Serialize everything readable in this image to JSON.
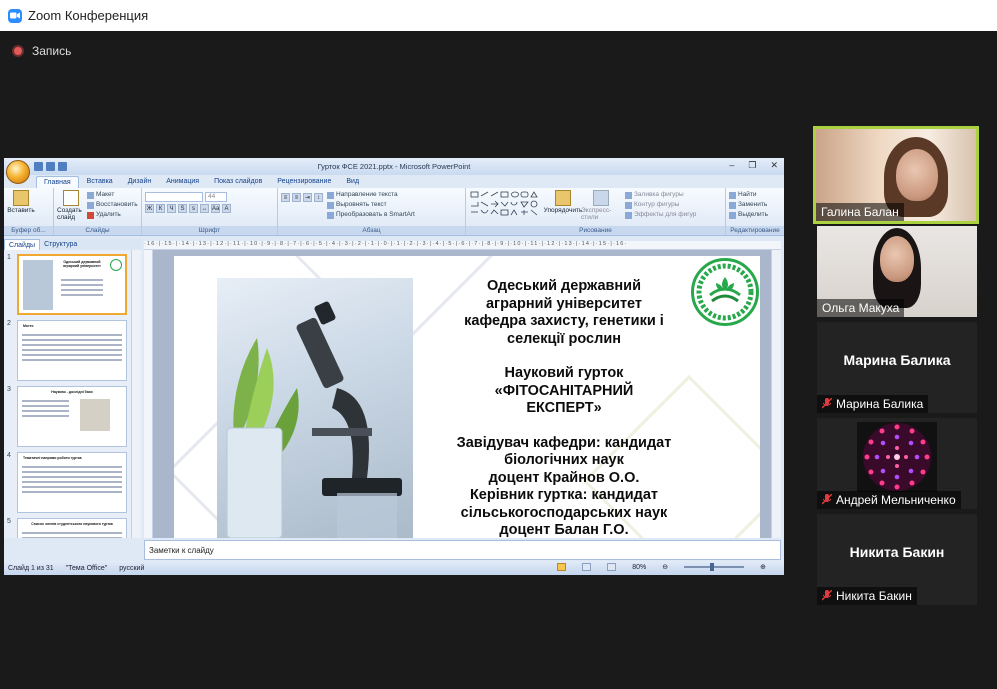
{
  "zoom": {
    "window_title": "Zoom Конференция",
    "recording_label": "Запись"
  },
  "ppt": {
    "window_title": "Гурток ФСЕ 2021.pptx - Microsoft PowerPoint",
    "tabs": [
      "Главная",
      "Вставка",
      "Дизайн",
      "Анимация",
      "Показ слайдов",
      "Рецензирование",
      "Вид"
    ],
    "ribbon": {
      "groups": [
        "Буфер об...",
        "Слайды",
        "Шрифт",
        "Абзац",
        "Рисование",
        "Редактирование"
      ],
      "paste": "Вставить",
      "create_slide": "Создать слайд",
      "layout": "Макет",
      "reset": "Восстановить",
      "delete": "Удалить",
      "font_size": "44",
      "text_direction": "Направление текста",
      "align_text": "Выровнять текст",
      "smartart": "Преобразовать в SmartArt",
      "arrange": "Упорядочить",
      "quick_styles": "Экспресс-стили",
      "shape_fill": "Заливка фигуры",
      "shape_outline": "Контур фигуры",
      "shape_effects": "Эффекты для фигур",
      "find": "Найти",
      "replace": "Заменить",
      "select": "Выделить"
    },
    "pane_tabs": [
      "Слайды",
      "Структура"
    ],
    "thumbnails": [
      {
        "num": "1",
        "title": "Одеський державний аграрний університет"
      },
      {
        "num": "2",
        "title": "Мотто"
      },
      {
        "num": "3",
        "title": "Науково - дослідні бази"
      },
      {
        "num": "4",
        "title": "Тематичні напрями роботи гуртка"
      },
      {
        "num": "5",
        "title": "Список членів студентського наукового гуртка"
      }
    ],
    "slide_text": [
      "Одеський державний",
      "аграрний університет",
      "кафедра захисту, генетики і",
      "селекції рослин",
      "",
      "Науковий гурток",
      "«ФІТОСАНІТАРНИЙ",
      "ЕКСПЕРТ»",
      "",
      "Завідувач кафедри: кандидат",
      "біологічних наук",
      "доцент  Крайнов О.О.",
      "Керівник гуртка: кандидат",
      "сільськогосподарських наук",
      "доцент Балан Г.О."
    ],
    "notes_placeholder": "Заметки к слайду",
    "status": {
      "slide": "Слайд 1 из 31",
      "theme": "\"Тема Office\"",
      "language": "русский",
      "zoom": "80%"
    }
  },
  "participants": [
    {
      "name": "Галина Балан",
      "video": true,
      "muted": false,
      "speaking": true
    },
    {
      "name": "Ольга Макуха",
      "video": true,
      "muted": false,
      "speaking": false
    },
    {
      "name": "Марина Балика",
      "video": false,
      "muted": true,
      "speaking": false
    },
    {
      "name": "Андрей Мельниченко",
      "video": true,
      "muted": true,
      "speaking": false
    },
    {
      "name": "Никита Бакин",
      "video": false,
      "muted": true,
      "speaking": false
    }
  ],
  "colors": {
    "zoom_blue": "#2d8cff",
    "active_speaker": "#a9d23e",
    "muted_red": "#e03e3e"
  }
}
